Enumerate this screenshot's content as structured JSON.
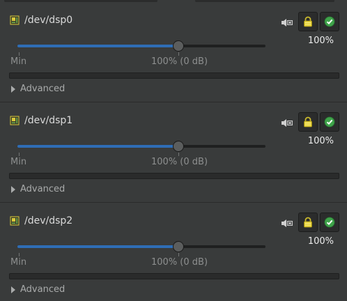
{
  "devices": [
    {
      "name": "/dev/dsp0",
      "volume_text": "100%",
      "volume_fraction": 0.65,
      "scale_min_label": "Min",
      "scale_mark_label": "100% (0 dB)",
      "advanced_label": "Advanced",
      "meter_level": 0
    },
    {
      "name": "/dev/dsp1",
      "volume_text": "100%",
      "volume_fraction": 0.65,
      "scale_min_label": "Min",
      "scale_mark_label": "100% (0 dB)",
      "advanced_label": "Advanced",
      "meter_level": 0
    },
    {
      "name": "/dev/dsp2",
      "volume_text": "100%",
      "volume_fraction": 0.65,
      "scale_min_label": "Min",
      "scale_mark_label": "100% (0 dB)",
      "advanced_label": "Advanced",
      "meter_level": 0
    }
  ],
  "icons": {
    "device": "sound-card-icon",
    "mute": "speaker-mute-icon",
    "lock": "lock-icon",
    "enable": "checkmark-icon"
  },
  "colors": {
    "accent": "#2f6db5",
    "background": "#393b3b",
    "lock_yellow": "#e8d43a",
    "check_green": "#3fa34a"
  }
}
